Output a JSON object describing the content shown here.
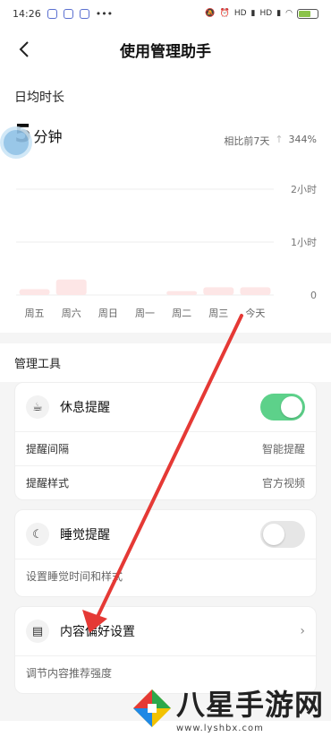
{
  "status_bar": {
    "time": "14:26",
    "dots": "•••",
    "signal_labels": [
      "HD",
      "HD"
    ],
    "battery": "68"
  },
  "header": {
    "back_icon": "chevron-left-icon",
    "title": "使用管理助手"
  },
  "daily_avg": {
    "section_title": "日均时长",
    "value": "5",
    "unit": "分钟",
    "compare_label": "相比前7天",
    "compare_value": "344%"
  },
  "chart_data": {
    "type": "bar",
    "categories": [
      "周五",
      "周六",
      "周日",
      "周一",
      "周二",
      "周三",
      "今天"
    ],
    "values": [
      3,
      8,
      0,
      0,
      2,
      4,
      4
    ],
    "y_ticks": [
      "2小时",
      "1小时",
      "0"
    ],
    "ylim": [
      0,
      120
    ],
    "bar_color": "#fde6e6"
  },
  "tools": {
    "section_title": "管理工具",
    "rest": {
      "label": "休息提醒",
      "enabled": true,
      "rows": [
        {
          "label": "提醒间隔",
          "value": "智能提醒"
        },
        {
          "label": "提醒样式",
          "value": "官方视频"
        }
      ]
    },
    "sleep": {
      "label": "睡觉提醒",
      "enabled": false,
      "sub": "设置睡觉时间和样式"
    },
    "content": {
      "label": "内容偏好设置",
      "sub": "调节内容推荐强度"
    }
  },
  "watermark": {
    "title": "八星手游网",
    "url": "www.lyshbx.com"
  },
  "colors": {
    "toggle_on": "#5dd18a",
    "annotation": "#e53935"
  }
}
